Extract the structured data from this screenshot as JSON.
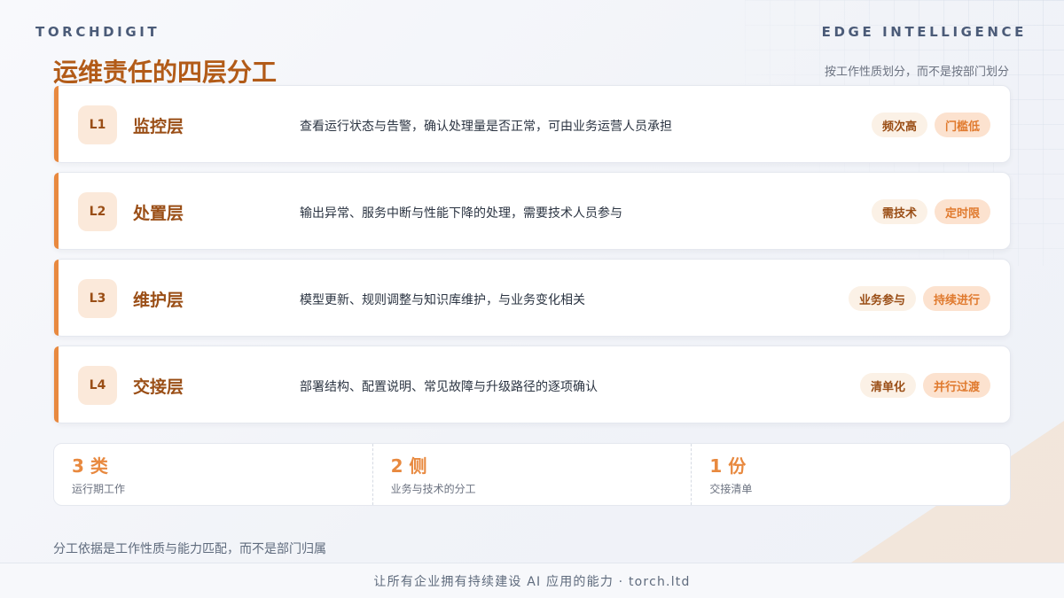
{
  "header": {
    "brand_left": "TORCHDIGIT",
    "brand_right": "EDGE INTELLIGENCE",
    "title": "运维责任的四层分工",
    "subtitle": "按工作性质划分，而不是按部门划分"
  },
  "layers": [
    {
      "code": "L1",
      "name": "监控层",
      "desc": "查看运行状态与告警，确认处理量是否正常，可由业务运营人员承担",
      "tags": [
        "频次高",
        "门槛低"
      ]
    },
    {
      "code": "L2",
      "name": "处置层",
      "desc": "输出异常、服务中断与性能下降的处理，需要技术人员参与",
      "tags": [
        "需技术",
        "定时限"
      ]
    },
    {
      "code": "L3",
      "name": "维护层",
      "desc": "模型更新、规则调整与知识库维护，与业务变化相关",
      "tags": [
        "业务参与",
        "持续进行"
      ]
    },
    {
      "code": "L4",
      "name": "交接层",
      "desc": "部署结构、配置说明、常见故障与升级路径的逐项确认",
      "tags": [
        "清单化",
        "并行过渡"
      ]
    }
  ],
  "stats": [
    {
      "value": "3 类",
      "label": "运行期工作"
    },
    {
      "value": "2 侧",
      "label": "业务与技术的分工"
    },
    {
      "value": "1 份",
      "label": "交接清单"
    }
  ],
  "footnote": "分工依据是工作性质与能力匹配，而不是部门归属",
  "footer": "让所有企业拥有持续建设 AI 应用的能力 · torch.ltd",
  "colors": {
    "accent": "#e8893f",
    "title": "#b25b18",
    "layer_text": "#9a4e16"
  }
}
